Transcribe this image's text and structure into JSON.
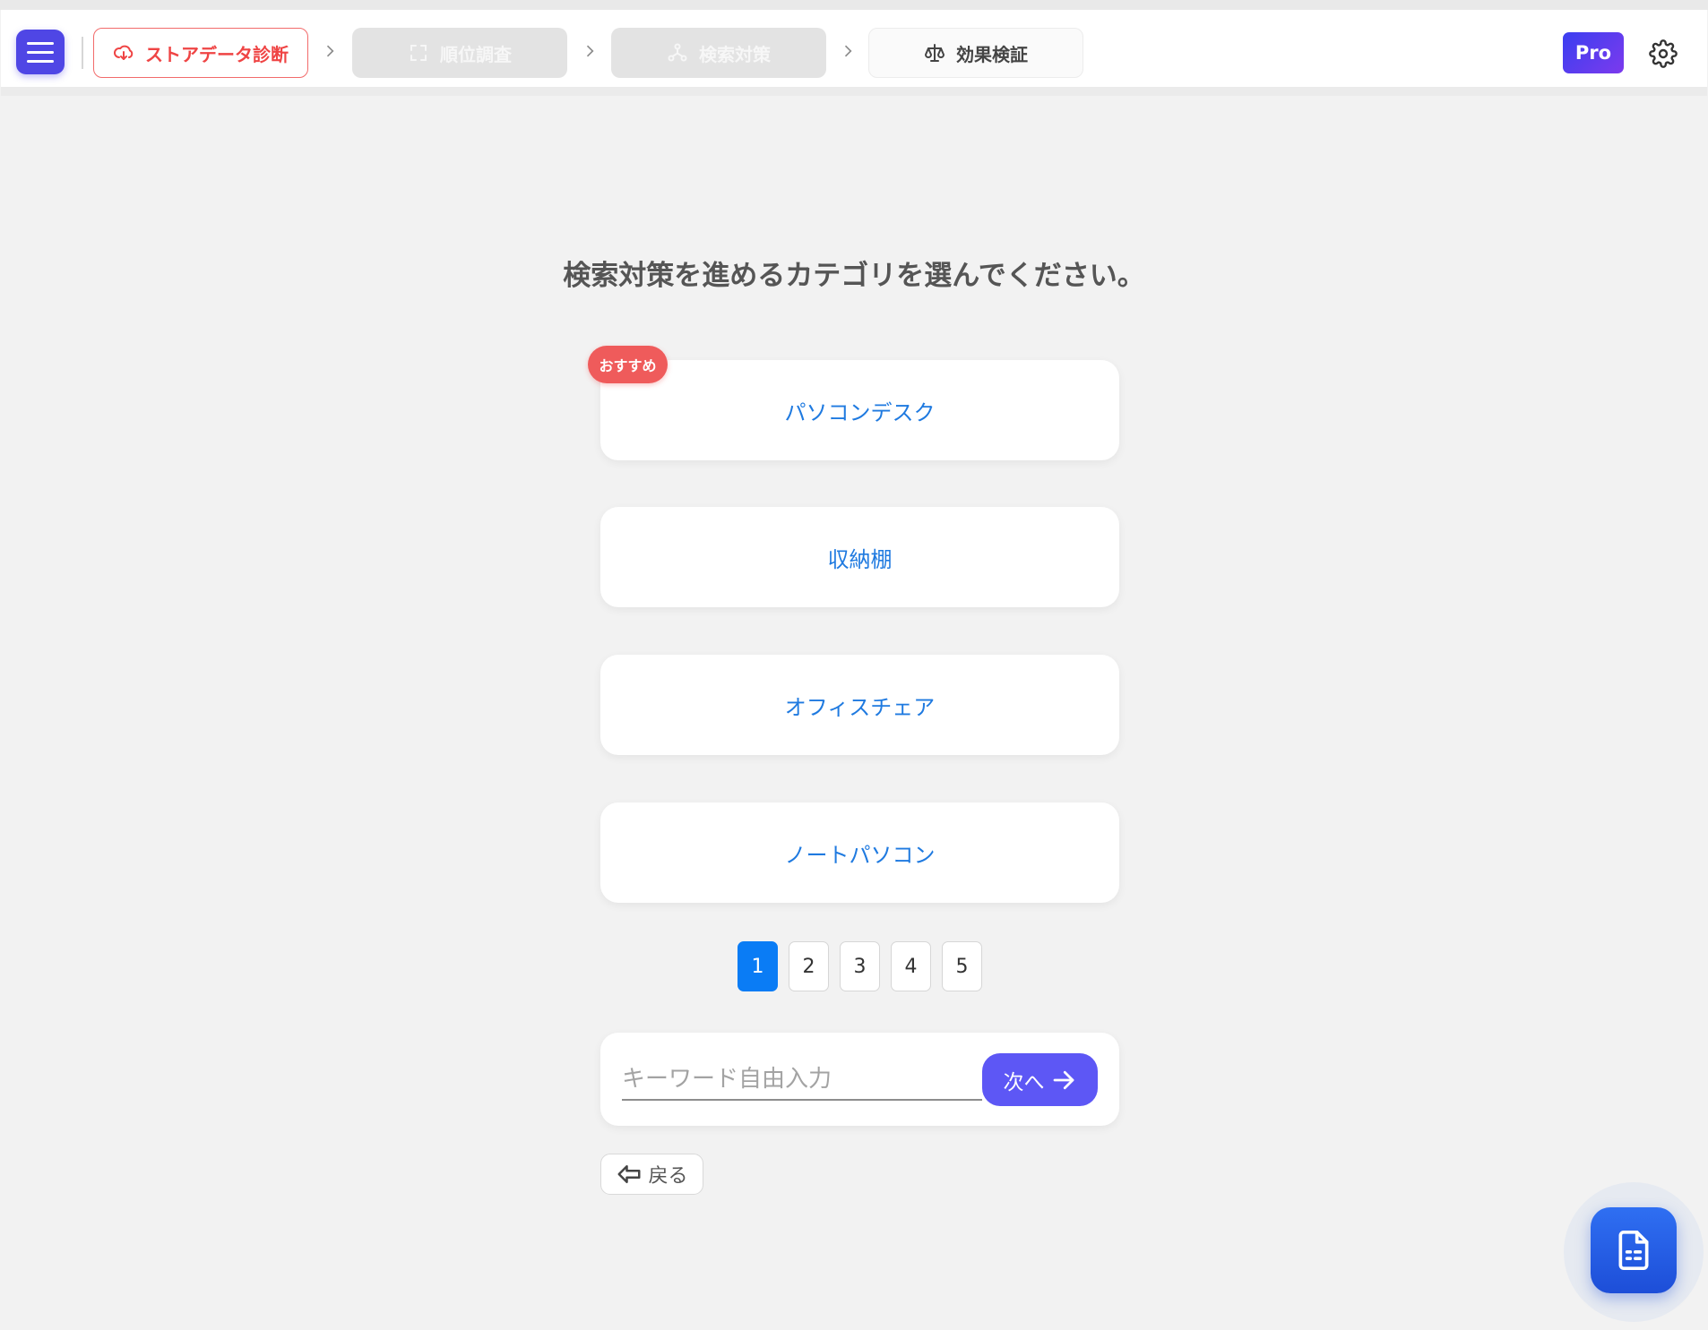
{
  "header": {
    "steps": [
      {
        "label": "ストアデータ診断",
        "icon": "cloud-download-icon",
        "state": "active"
      },
      {
        "label": "順位調査",
        "icon": "expand-icon",
        "state": "disabled"
      },
      {
        "label": "検索対策",
        "icon": "network-icon",
        "state": "disabled"
      },
      {
        "label": "効果検証",
        "icon": "scale-icon",
        "state": "default"
      }
    ],
    "pro_label": "Pro"
  },
  "main": {
    "prompt": "検索対策を進めるカテゴリを選んでください。",
    "recommend_badge": "おすすめ",
    "categories": [
      "パソコンデスク",
      "収納棚",
      "オフィスチェア",
      "ノートパソコン"
    ],
    "pages": [
      "1",
      "2",
      "3",
      "4",
      "5"
    ],
    "current_page": "1",
    "keyword_placeholder": "キーワード自由入力",
    "keyword_value": "",
    "next_label": "次へ",
    "back_label": "戻る"
  },
  "colors": {
    "accent": "#4f46e5",
    "step_active": "#ef4444",
    "link_blue": "#1f7ae0",
    "page_active": "#0a7cf5",
    "badge_red": "#ef5b5b",
    "next_button": "#5d57f5",
    "fab": "#1d4ed8"
  }
}
